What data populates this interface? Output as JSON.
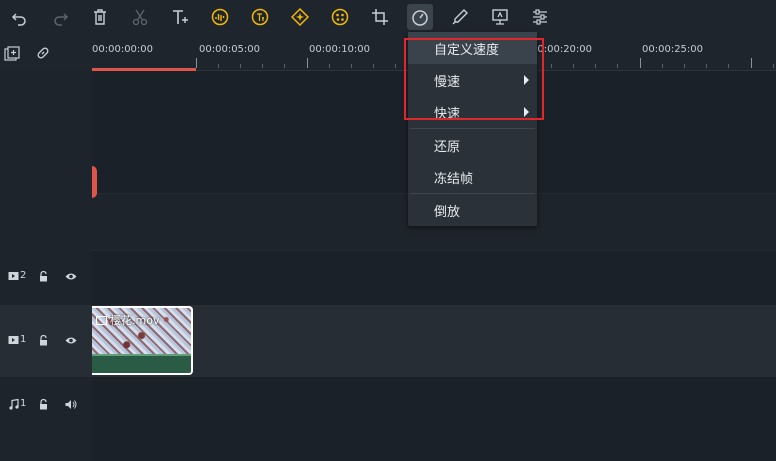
{
  "toolbar": {
    "icons": [
      "undo-icon",
      "redo-icon",
      "delete-icon",
      "cut-icon",
      "text-icon",
      "audio-stretch-icon",
      "tts-icon",
      "ai-icon",
      "color-icon",
      "crop-icon",
      "speed-icon",
      "color-picker-icon",
      "present-icon",
      "adjust-icon"
    ],
    "accent": "#f5b800"
  },
  "timeline": {
    "timecodes": [
      "00:00:00:00",
      "00:00:05:00",
      "00:00:10:00",
      "00:00:20:00",
      "00:00:25:00"
    ],
    "tracks": [
      {
        "label": "2",
        "kind": "video"
      },
      {
        "label": "1",
        "kind": "video"
      },
      {
        "label": "1",
        "kind": "audio"
      }
    ],
    "clip": {
      "name": "樱花.mov"
    }
  },
  "speed_menu": {
    "items": [
      {
        "label": "自定义速度",
        "submenu": false,
        "highlighted": true
      },
      {
        "label": "慢速",
        "submenu": true,
        "highlighted": false
      },
      {
        "label": "快速",
        "submenu": true,
        "highlighted": false
      },
      {
        "label": "还原",
        "submenu": false,
        "highlighted": false
      },
      {
        "label": "冻结帧",
        "submenu": false,
        "highlighted": false
      },
      {
        "label": "倒放",
        "submenu": false,
        "highlighted": false
      }
    ]
  },
  "colors": {
    "highlight_box": "#e0282c",
    "playhead": "#e0554a",
    "clip_border": "#ffffff"
  }
}
